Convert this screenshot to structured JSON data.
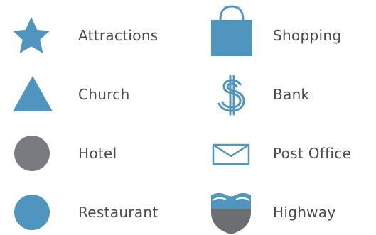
{
  "legend": {
    "items": [
      {
        "label": "Attractions",
        "icon": "star-icon",
        "color": "#4f95c0"
      },
      {
        "label": "Shopping",
        "icon": "shopping-bag-icon",
        "color": "#4f95c0"
      },
      {
        "label": "Church",
        "icon": "triangle-icon",
        "color": "#4f95c0"
      },
      {
        "label": "Bank",
        "icon": "dollar-sign-icon",
        "color": "#4f95c0"
      },
      {
        "label": "Hotel",
        "icon": "circle-icon",
        "color": "#7a7b80"
      },
      {
        "label": "Post Office",
        "icon": "envelope-icon",
        "color": "#4f95c0"
      },
      {
        "label": "Restaurant",
        "icon": "circle-icon",
        "color": "#4f95c0"
      },
      {
        "label": "Highway",
        "icon": "highway-shield-icon",
        "color": "#6d6e73"
      }
    ]
  },
  "colors": {
    "blue": "#4f95c0",
    "grey": "#7a7b80",
    "text": "#4a4a4a"
  }
}
